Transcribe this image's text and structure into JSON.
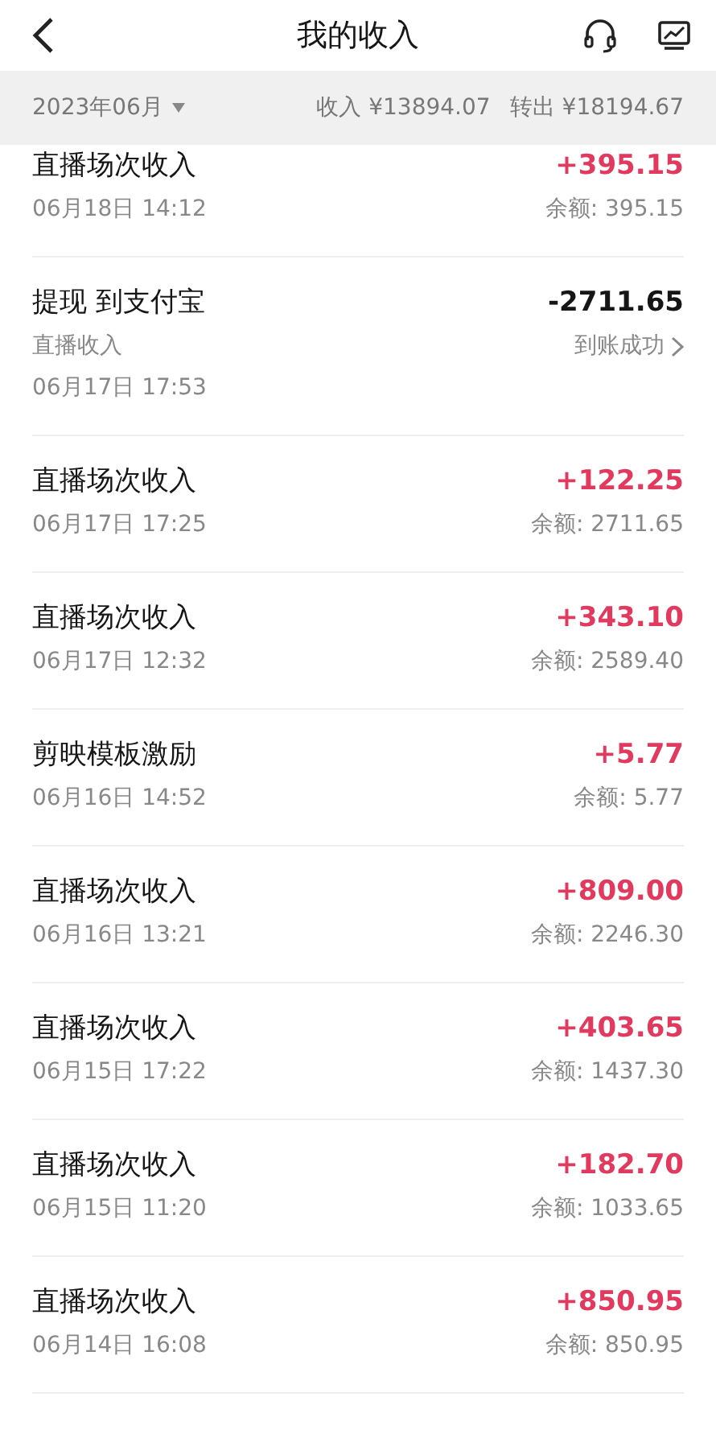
{
  "header": {
    "title": "我的收入"
  },
  "summary": {
    "month": "2023年06月",
    "income_label": "收入",
    "income": "¥13894.07",
    "out_label": "转出",
    "out": "¥18194.67"
  },
  "records": [
    {
      "kind": "income",
      "title": "直播场次收入",
      "date": "06月18日 14:12",
      "amount": "+395.15",
      "note": "余额: 395.15"
    },
    {
      "kind": "withdrawal",
      "title": "提现 到支付宝",
      "subtitle": "直播收入",
      "date": "06月17日 17:53",
      "amount": "-2711.65",
      "note": "到账成功"
    },
    {
      "kind": "income",
      "title": "直播场次收入",
      "date": "06月17日 17:25",
      "amount": "+122.25",
      "note": "余额: 2711.65"
    },
    {
      "kind": "income",
      "title": "直播场次收入",
      "date": "06月17日 12:32",
      "amount": "+343.10",
      "note": "余额: 2589.40"
    },
    {
      "kind": "income",
      "title": "剪映模板激励",
      "date": "06月16日 14:52",
      "amount": "+5.77",
      "note": "余额: 5.77"
    },
    {
      "kind": "income",
      "title": "直播场次收入",
      "date": "06月16日 13:21",
      "amount": "+809.00",
      "note": "余额: 2246.30"
    },
    {
      "kind": "income",
      "title": "直播场次收入",
      "date": "06月15日 17:22",
      "amount": "+403.65",
      "note": "余额: 1437.30"
    },
    {
      "kind": "income",
      "title": "直播场次收入",
      "date": "06月15日 11:20",
      "amount": "+182.70",
      "note": "余额: 1033.65"
    },
    {
      "kind": "income",
      "title": "直播场次收入",
      "date": "06月14日 16:08",
      "amount": "+850.95",
      "note": "余额: 850.95"
    }
  ]
}
